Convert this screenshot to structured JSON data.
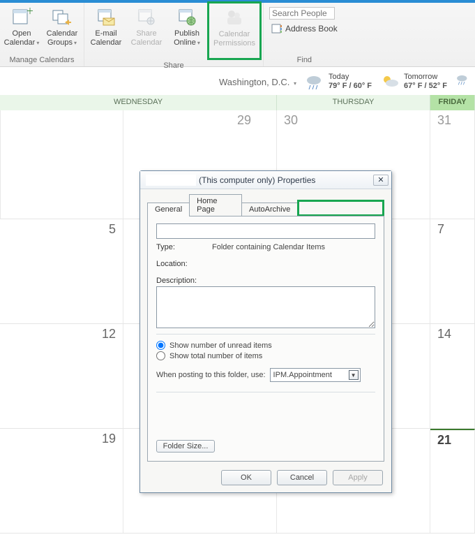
{
  "ribbon": {
    "groups": {
      "manage": {
        "label": "Manage Calendars",
        "open_calendar": "Open Calendar",
        "calendar_groups": "Calendar Groups"
      },
      "share": {
        "label": "Share",
        "email_calendar": "E-mail Calendar",
        "share_calendar": "Share Calendar",
        "publish_online": "Publish Online",
        "calendar_permissions": "Calendar Permissions"
      },
      "find": {
        "label": "Find",
        "search_placeholder": "Search People",
        "address_book": "Address Book"
      }
    }
  },
  "weather": {
    "city": "Washington,  D.C.",
    "today": {
      "label": "Today",
      "temps": "79° F / 60° F"
    },
    "tomorrow": {
      "label": "Tomorrow",
      "temps": "67° F / 52° F"
    }
  },
  "calendar": {
    "headers": {
      "wed": "WEDNESDAY",
      "thu": "THURSDAY",
      "fri": "FRIDAY"
    },
    "rows": [
      {
        "wed": "29",
        "thu": "30",
        "fri": "31"
      },
      {
        "wed": "5",
        "thu": "",
        "fri": "7"
      },
      {
        "wed": "12",
        "thu": "",
        "fri": "14"
      },
      {
        "wed": "19",
        "thu": "",
        "fri": "21"
      }
    ]
  },
  "dialog": {
    "title": "(This computer only) Properties",
    "tabs": {
      "general": "General",
      "homepage": "Home Page",
      "autoarchive": "AutoArchive"
    },
    "type_label": "Type:",
    "type_value": "Folder containing Calendar Items",
    "location_label": "Location:",
    "description_label": "Description:",
    "radio_unread": "Show number of unread items",
    "radio_total": "Show total number of items",
    "posting_label": "When posting to this folder, use:",
    "posting_value": "IPM.Appointment",
    "folder_size": "Folder Size...",
    "ok": "OK",
    "cancel": "Cancel",
    "apply": "Apply"
  }
}
